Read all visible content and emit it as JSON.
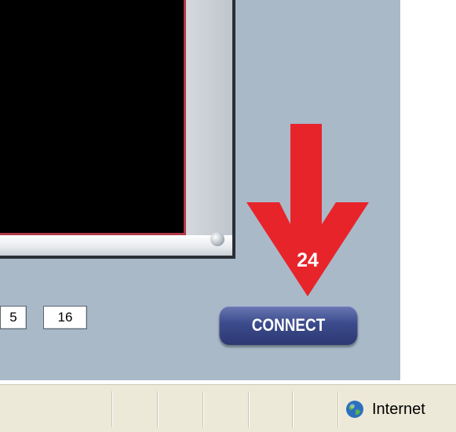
{
  "viewer": {
    "channels": [
      {
        "label": "5"
      },
      {
        "label": "16"
      }
    ],
    "connect_label": "CONNECT"
  },
  "annotation": {
    "number": "24",
    "color": "#e8242b"
  },
  "statusbar": {
    "zone_label": "Internet",
    "zone_icon": "globe-icon"
  },
  "colors": {
    "panel": "#a9b9c8",
    "button": "#3c4b8c",
    "statusbar": "#ece9d8"
  }
}
